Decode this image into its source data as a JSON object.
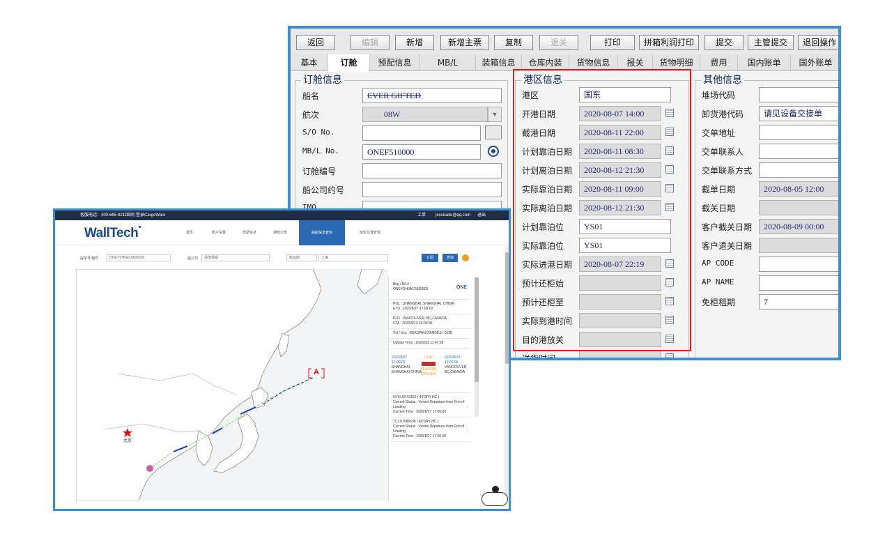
{
  "erp": {
    "toolbar": [
      {
        "label": "返回",
        "enabled": true
      },
      {
        "label": "编辑",
        "enabled": false
      },
      {
        "label": "新增",
        "enabled": true
      },
      {
        "label": "新增主票",
        "enabled": true
      },
      {
        "label": "复制",
        "enabled": true
      },
      {
        "label": "退关",
        "enabled": false
      },
      {
        "label": "打印",
        "enabled": true
      },
      {
        "label": "拼箱利润打印",
        "enabled": true
      },
      {
        "label": "提交",
        "enabled": true
      },
      {
        "label": "主管提交",
        "enabled": true
      },
      {
        "label": "退回操作",
        "enabled": true
      }
    ],
    "tabs": [
      "基本",
      "订舱",
      "预配信息",
      "MB/L",
      "装箱信息",
      "仓库内装",
      "货物信息",
      "报关",
      "货物明细",
      "费用",
      "国内账单",
      "国外账单"
    ],
    "active_tab": "订舱",
    "booking": {
      "title": "订舱信息",
      "fields": [
        {
          "label": "船名",
          "value": "EVER GIFTED"
        },
        {
          "label": "航次",
          "value": "08W"
        },
        {
          "label": "S/O No.",
          "value": ""
        },
        {
          "label": "MB/L No.",
          "value": "ONEF510000"
        },
        {
          "label": "订舱编号",
          "value": ""
        },
        {
          "label": "船公司约号",
          "value": ""
        },
        {
          "label": "IMO",
          "value": ""
        }
      ]
    },
    "port": {
      "title": "港区信息",
      "fields": [
        {
          "label": "港区",
          "value": "国东"
        },
        {
          "label": "开港日期",
          "value": "2020-08-07 14:00"
        },
        {
          "label": "截港日期",
          "value": "2020-08-11 22:00"
        },
        {
          "label": "计划靠泊日期",
          "value": "2020-08-11 08:30"
        },
        {
          "label": "计划离泊日期",
          "value": "2020-08-12 21:30"
        },
        {
          "label": "实际靠泊日期",
          "value": "2020-08-11 09:00"
        },
        {
          "label": "实际离泊日期",
          "value": "2020-08-12 21:30"
        },
        {
          "label": "计划靠泊位",
          "value": "YS01"
        },
        {
          "label": "实际靠泊位",
          "value": "YS01"
        },
        {
          "label": "实际进港日期",
          "value": "2020-08-07 22:19"
        },
        {
          "label": "预计还柜始",
          "value": ""
        },
        {
          "label": "预计还柜至",
          "value": ""
        },
        {
          "label": "实际到港时间",
          "value": ""
        },
        {
          "label": "目的港放关",
          "value": ""
        },
        {
          "label": "送货时间",
          "value": ""
        }
      ]
    },
    "other": {
      "title": "其他信息",
      "fields": [
        {
          "label": "堆场代码",
          "value": ""
        },
        {
          "label": "卸货港代码",
          "value": "请见设备交接单"
        },
        {
          "label": "交单地址",
          "value": ""
        },
        {
          "label": "交单联系人",
          "value": ""
        },
        {
          "label": "交单联系方式",
          "value": ""
        },
        {
          "label": "截单日期",
          "value": "2020-08-05 12:00"
        },
        {
          "label": "截关日期",
          "value": ""
        },
        {
          "label": "客户截关日期",
          "value": "2020-08-09 00:00"
        },
        {
          "label": "客户退关日期",
          "value": ""
        },
        {
          "label": "AP CODE",
          "value": ""
        },
        {
          "label": "AP NAME",
          "value": ""
        },
        {
          "label": "免柜租期",
          "value": "7"
        }
      ]
    }
  },
  "track": {
    "topbar": {
      "hotline": "客服电话：400-665-9211",
      "website": "官网",
      "login": "登录CargoWare",
      "work": "工单",
      "email": "jessicaliu@qq.com",
      "logout": "退出"
    },
    "logo": "WallTech",
    "nav": [
      "首页",
      "账户设置",
      "帮助信息",
      "通知公告",
      "船舶信息查询",
      "班轮位置查询"
    ],
    "active_nav": "船舶信息查询",
    "search": {
      "label": "提单号/箱号",
      "value": "ONEYSH0AC6839500",
      "company_label": "船公司",
      "company_value": "请选择船",
      "route_value": "航运商",
      "region_value": "上海",
      "btn_order": "订阅",
      "btn_query": "查询"
    },
    "map": {
      "capital_label": "北京",
      "destination_marker": "A"
    },
    "panel": {
      "bkg_label": "Bkg / B/L# :",
      "bkg_value": "ONEYSH0AC6839500",
      "carrier": "ONE",
      "pol": "POL : SHANGHAI, SHANGHAI, CHINA",
      "etd": "ETD : 2020/8/27 17:00:00",
      "pld": "PLD : VANCOUVER, BC,CANADA",
      "eta": "ETA : 2020/9/13 19:00:00",
      "vessel": "Vsl / Voy : SEASPAN GANGES / 019E",
      "update": "Update Time : 2020/9/3 11:47:59",
      "dep_date": "2020/8/27",
      "dep_time": "17:00:00",
      "dep_port": "SHANGHAI, SHANGHAI,CHINA",
      "voyage": "019E",
      "ship_name": "SEASPAN GANGES",
      "arr_date": "2020/9/13",
      "arr_time": "19:00:00",
      "arr_port": "VANCOUVER, BC,CANADA",
      "containers": [
        {
          "no": "NYKU0743150 ( 40'DRY HC )",
          "status": "Current Status : Vessel Departure from Port of Loading",
          "time": "Current Time : 2020/8/27 17:00:00"
        },
        {
          "no": "TCLU1586608 ( 40'DRY HC )",
          "status": "Current Status : Vessel Departure from Port of Loading",
          "time": "Current Time : 2020/8/27 17:00:00"
        }
      ]
    }
  },
  "colors": {
    "accent_blue": "#3a8fd6",
    "nav_blue": "#2a6ab5",
    "highlight_red": "#e0201b",
    "route_blue": "#1a3cc8"
  }
}
